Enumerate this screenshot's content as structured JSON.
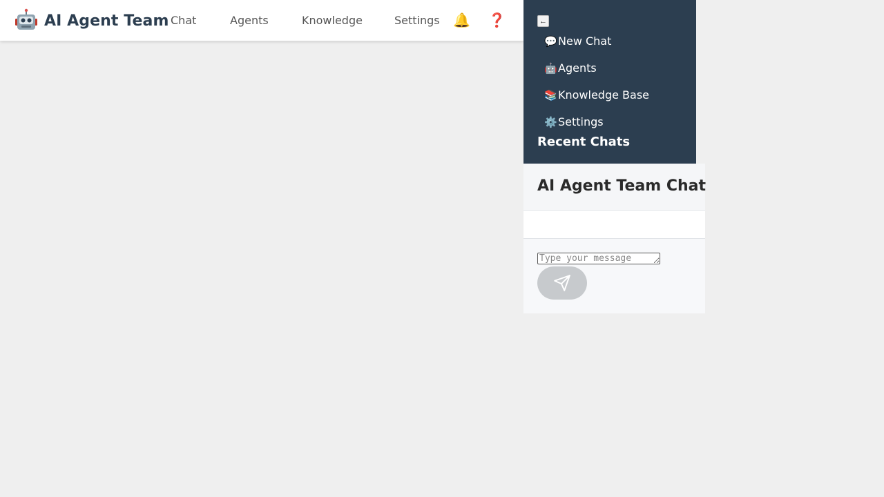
{
  "app": {
    "title": "AI Agent Team",
    "brand_icon": "robot-icon"
  },
  "nav": {
    "items": [
      {
        "label": "Chat"
      },
      {
        "label": "Agents"
      },
      {
        "label": "Knowledge"
      },
      {
        "label": "Settings"
      }
    ],
    "notification_icon": "bell-icon",
    "help_icon": "question-mark-icon",
    "bell_glyph": "🔔",
    "help_glyph": "❓"
  },
  "sidebar": {
    "collapse_label": "←",
    "items": [
      {
        "label": "New Chat",
        "icon": "speech-bubble-icon",
        "glyph": "💬"
      },
      {
        "label": "Agents",
        "icon": "robot-icon",
        "glyph": "🤖"
      },
      {
        "label": "Knowledge Base",
        "icon": "books-icon",
        "glyph": "📚"
      },
      {
        "label": "Settings",
        "icon": "gear-icon",
        "glyph": "⚙️"
      }
    ],
    "recent_title": "Recent Chats"
  },
  "chat": {
    "title": "AI Agent Team Chat",
    "input_placeholder": "Type your message",
    "send_icon": "paper-plane-icon"
  },
  "colors": {
    "sidebar_bg": "#2c3e50",
    "brand_text": "#2c3e50",
    "page_bg": "#efefef",
    "send_button": "#c7cacd"
  }
}
